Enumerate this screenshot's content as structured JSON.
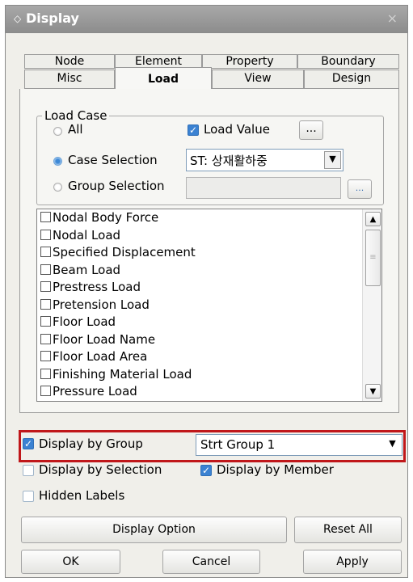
{
  "window": {
    "title": "Display",
    "close_glyph": "×"
  },
  "tabs_row1": [
    "Node",
    "Element",
    "Property",
    "Boundary"
  ],
  "tabs_row2": [
    "Misc",
    "Load",
    "View",
    "Design"
  ],
  "active_tab": "Load",
  "load_case": {
    "legend": "Load Case",
    "all_label": "All",
    "load_value_label": "Load Value",
    "load_value_checked": true,
    "load_value_button": "...",
    "case_selection_label": "Case Selection",
    "case_value": "ST: 상재활하중",
    "group_selection_label": "Group Selection",
    "group_button": "...",
    "selected_radio": "case_selection"
  },
  "load_items": [
    "Nodal Body Force",
    "Nodal Load",
    "Specified Displacement",
    "Beam Load",
    "Prestress Load",
    "Pretension Load",
    "Floor Load",
    "Floor Load Name",
    "Floor Load Area",
    "Finishing Material Load",
    "Pressure Load"
  ],
  "display_by_group": {
    "label": "Display by Group",
    "checked": true,
    "value": "Strt Group 1"
  },
  "display_by_selection": {
    "label": "Display by Selection",
    "checked": false
  },
  "display_by_member": {
    "label": "Display by Member",
    "checked": true
  },
  "hidden_labels": {
    "label": "Hidden Labels",
    "checked": false
  },
  "buttons": {
    "display_option": "Display Option",
    "reset_all": "Reset All",
    "ok": "OK",
    "cancel": "Cancel",
    "apply": "Apply"
  },
  "colors": {
    "highlight_border": "#c0171a",
    "accent": "#3b82d2"
  }
}
